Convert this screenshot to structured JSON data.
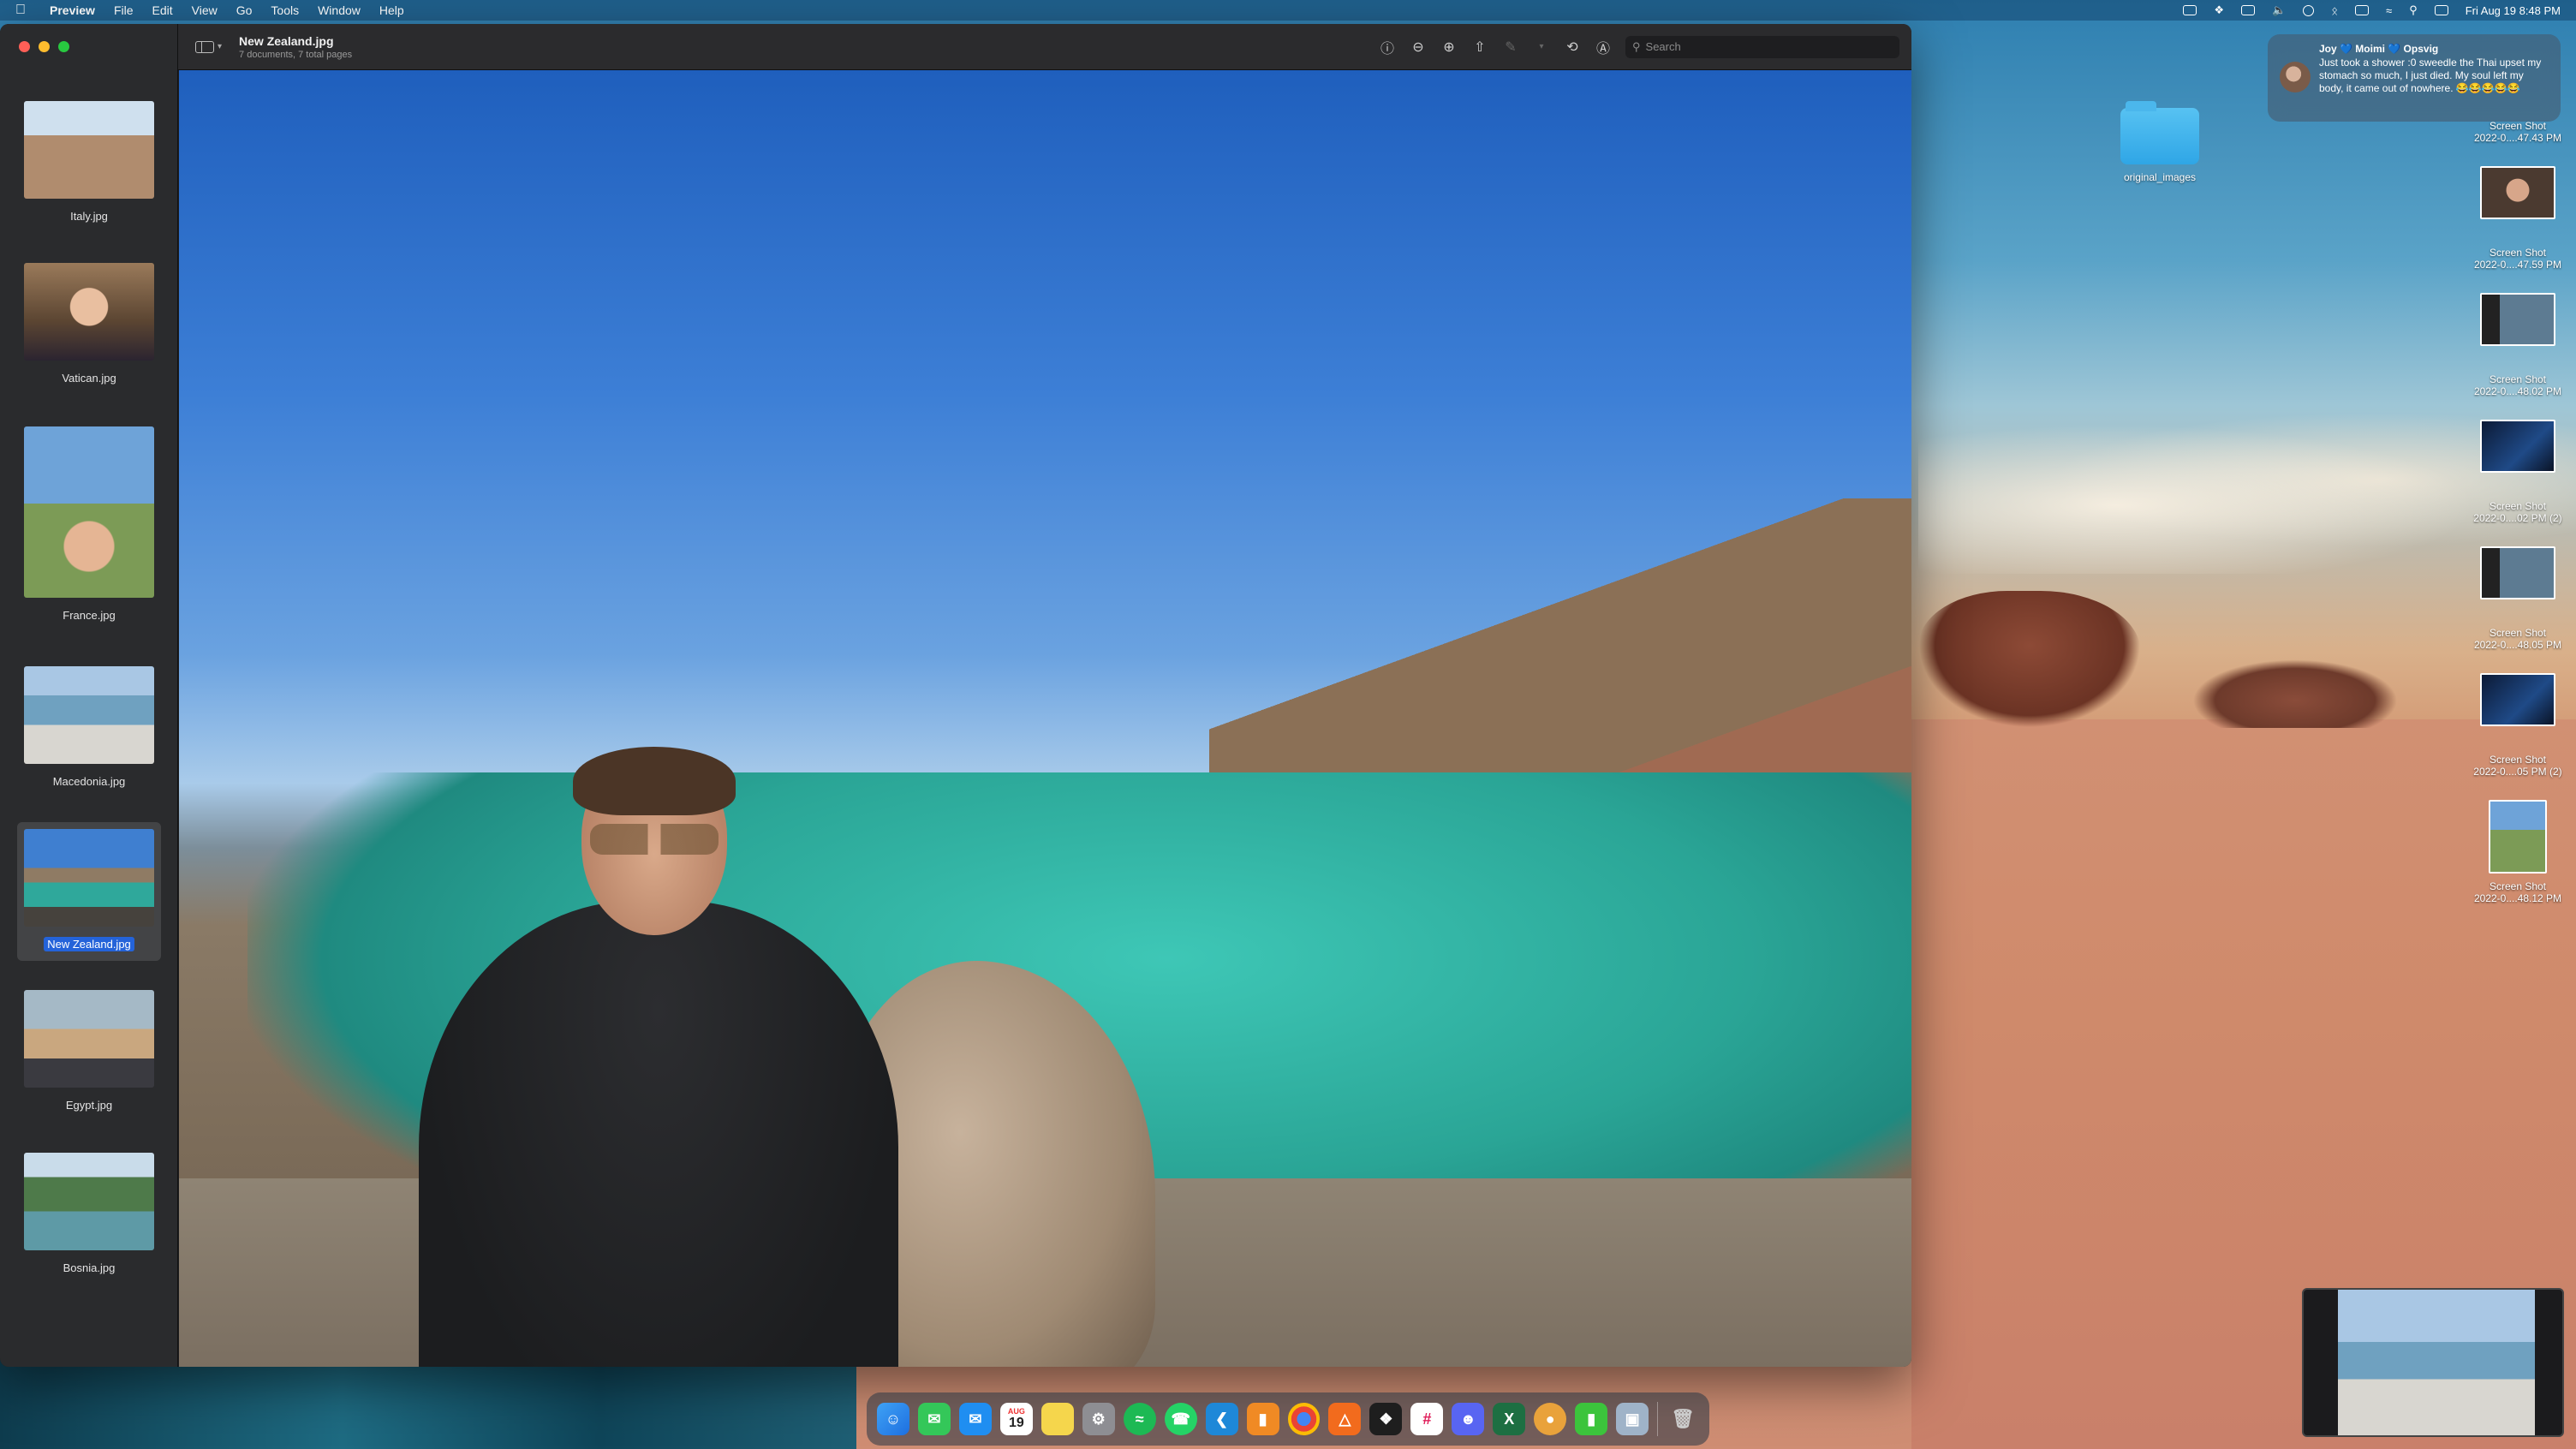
{
  "menubar": {
    "app_name": "Preview",
    "menus": [
      "File",
      "Edit",
      "View",
      "Go",
      "Tools",
      "Window",
      "Help"
    ],
    "clock": "Fri Aug 19  8:48 PM"
  },
  "window": {
    "document_title": "New Zealand.jpg",
    "document_subtitle": "7 documents, 7 total pages",
    "search_placeholder": "Search"
  },
  "sidebar": {
    "thumbnails": [
      {
        "label": "Italy.jpg"
      },
      {
        "label": "Vatican.jpg"
      },
      {
        "label": "France.jpg"
      },
      {
        "label": "Macedonia.jpg"
      },
      {
        "label": "New Zealand.jpg",
        "selected": true
      },
      {
        "label": "Egypt.jpg"
      },
      {
        "label": "Bosnia.jpg"
      }
    ]
  },
  "desktop": {
    "folder_label": "original_images",
    "screenshots": [
      {
        "line1": "Screen Shot",
        "line2": "2022-0....47.43 PM"
      },
      {
        "line1": "Screen Shot",
        "line2": "2022-0....47.59 PM"
      },
      {
        "line1": "Screen Shot",
        "line2": "2022-0....48.02 PM"
      },
      {
        "line1": "Screen Shot",
        "line2": "2022-0....02 PM (2)"
      },
      {
        "line1": "Screen Shot",
        "line2": "2022-0....48.05 PM"
      },
      {
        "line1": "Screen Shot",
        "line2": "2022-0....05 PM (2)"
      },
      {
        "line1": "Screen Shot",
        "line2": "2022-0....48.12 PM"
      }
    ]
  },
  "notification": {
    "from": "Joy 💙 Moimi 💙 Opsvig",
    "message": "Just took a shower :0 sweedle the Thai upset my stomach so much, I just died. My soul left my body, it came out of nowhere. 😂😂😂😂😂"
  },
  "dock": {
    "calendar_day": "19",
    "calendar_month": "AUG"
  }
}
